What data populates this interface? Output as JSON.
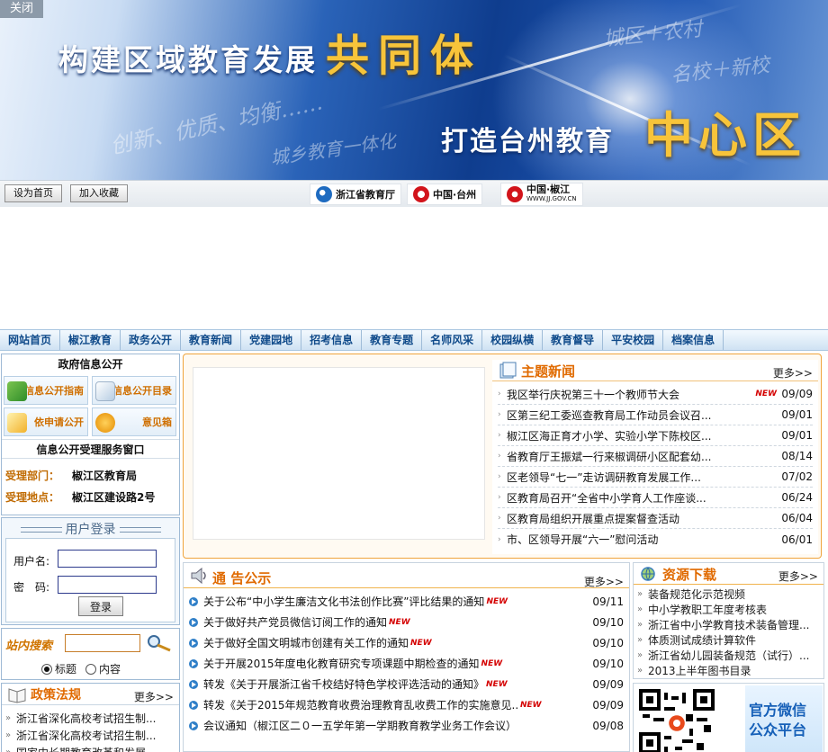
{
  "banner": {
    "close_label": "关闭",
    "title_main": "构建区域教育发展",
    "title_main_em": "共同体",
    "title_sub": "打造台州教育",
    "title_sub_em": "中心区",
    "script_a": "创新、优质、均衡……",
    "script_b": "城乡教育一体化",
    "script_c": "城区＋农村",
    "script_d": "名校＋新校"
  },
  "toolbar": {
    "set_home": "设为首页",
    "add_fav": "加入收藏",
    "logos": [
      "浙江省教育厅",
      "中国·台州",
      "中国·椒江"
    ],
    "logo_sub": "WWW.JJ.GOV.CN"
  },
  "nav": [
    "网站首页",
    "椒江教育",
    "政务公开",
    "教育新闻",
    "党建园地",
    "招考信息",
    "教育专题",
    "名师风采",
    "校园纵横",
    "教育督导",
    "平安校园",
    "档案信息"
  ],
  "gov_info": {
    "title": "政府信息公开",
    "buttons": [
      "信息公开指南",
      "信息公开目录",
      "依申请公开",
      "意见箱"
    ],
    "window_title": "信息公开受理服务窗口",
    "dept_label": "受理部门：",
    "dept_value": "椒江区教育局",
    "addr_label": "受理地点：",
    "addr_value": "椒江区建设路2号"
  },
  "login": {
    "title": "用户登录",
    "user_label": "用户名:",
    "pwd_label": "密　码:",
    "button": "登录"
  },
  "search": {
    "title": "站内搜索",
    "opt_title": "标题",
    "opt_content": "内容",
    "selected": "标题"
  },
  "theme_news": {
    "title": "主题新闻",
    "more": "更多>>",
    "new_tag": "NEW",
    "items": [
      {
        "title": "我区举行庆祝第三十一个教师节大会",
        "date": "09/09",
        "new": true
      },
      {
        "title": "区第三纪工委巡查教育局工作动员会议召...",
        "date": "09/01",
        "new": false
      },
      {
        "title": "椒江区海正育才小学、实验小学下陈校区...",
        "date": "09/01",
        "new": false
      },
      {
        "title": "省教育厅王振斌一行来椒调研小区配套幼...",
        "date": "08/14",
        "new": false
      },
      {
        "title": "区老领导“七一”走访调研教育发展工作...",
        "date": "07/02",
        "new": false
      },
      {
        "title": "区教育局召开“全省中小学育人工作座谈...",
        "date": "06/24",
        "new": false
      },
      {
        "title": "区教育局组织开展重点提案督查活动",
        "date": "06/04",
        "new": false
      },
      {
        "title": "市、区领导开展“六一”慰问活动",
        "date": "06/01",
        "new": false
      }
    ]
  },
  "notices": {
    "title": "通 告公示",
    "more": "更多>>",
    "new_tag": "NEW",
    "items": [
      {
        "title": "关于公布“中小学生廉洁文化书法创作比赛”评比结果的通知",
        "date": "09/11",
        "new": true
      },
      {
        "title": "关于做好共产党员微信订阅工作的通知",
        "date": "09/10",
        "new": true
      },
      {
        "title": "关于做好全国文明城市创建有关工作的通知",
        "date": "09/10",
        "new": true
      },
      {
        "title": "关于开展2015年度电化教育研究专项课题中期检查的通知",
        "date": "09/10",
        "new": true
      },
      {
        "title": "转发《关于开展浙江省千校结好特色学校评选活动的通知》",
        "date": "09/09",
        "new": true
      },
      {
        "title": "转发《关于2015年规范教育收费治理教育乱收费工作的实施意见...",
        "date": "09/09",
        "new": true
      },
      {
        "title": "会议通知（椒江区二０一五学年第一学期教育教学业务工作会议）",
        "date": "09/08",
        "new": false
      }
    ]
  },
  "downloads": {
    "title": "资源下载",
    "more": "更多>>",
    "items": [
      "装备规范化示范视频",
      "中小学教职工年度考核表",
      "浙江省中小学教育技术装备管理...",
      "体质测试成绩计算软件",
      "浙江省幼儿园装备规范（试行）...",
      "2013上半年图书目录"
    ]
  },
  "policy": {
    "title": "政策法规",
    "more": "更多>>",
    "items": [
      "浙江省深化高校考试招生制...",
      "浙江省深化高校考试招生制...",
      "国家中长期教育改革和发展..."
    ]
  },
  "wechat": {
    "line1": "官方微信",
    "line2": "公众平台"
  },
  "colors": {
    "accent_orange": "#e06a00",
    "nav_text": "#0f4a8a",
    "new_red": "#d40000",
    "banner_gold": "#f7c43a"
  }
}
